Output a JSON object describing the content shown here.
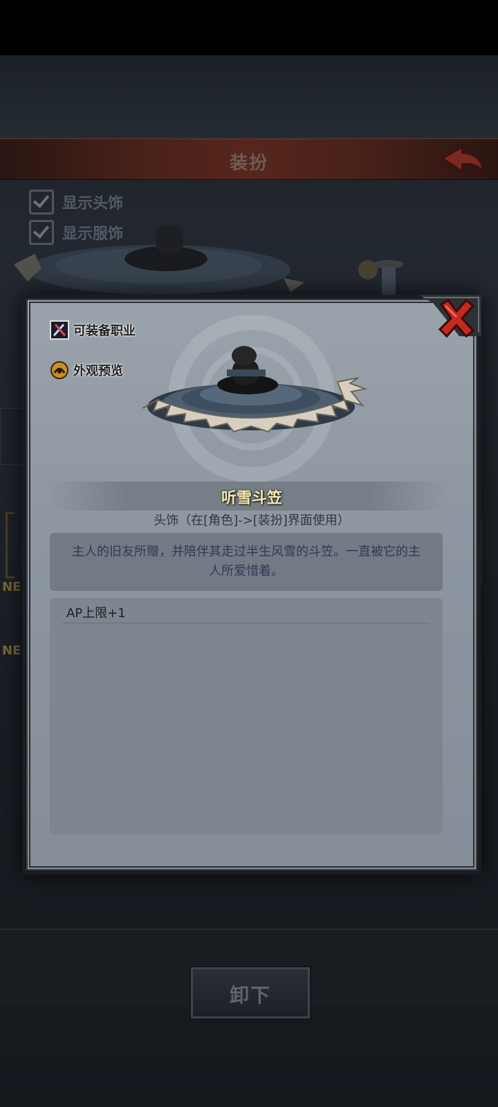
{
  "screen": {
    "title": "装扮",
    "options": [
      {
        "label": "显示头饰",
        "checked": true
      },
      {
        "label": "显示服饰",
        "checked": true
      }
    ],
    "side_labels": [
      "NE",
      "NE"
    ],
    "unequip_label": "卸下"
  },
  "modal": {
    "side_buttons": [
      {
        "label": "可装备职业",
        "icon": "sword-staff-icon"
      },
      {
        "label": "外观预览",
        "icon": "preview-icon"
      }
    ],
    "item": {
      "name": "听雪斗笠",
      "type": "头饰（在[角色]->[装扮]界面使用）",
      "description": "主人的旧友所赠，并陪伴其走过半生风雪的斗笠。一直被它的主人所爱惜着。",
      "attributes": [
        "AP上限+1"
      ],
      "image": "straw-hat-icon"
    },
    "close_icon": "close-icon"
  },
  "colors": {
    "accent_red": "#c4281e",
    "item_name": "#f5e9b0",
    "modal_bg": "#8e97a1"
  }
}
